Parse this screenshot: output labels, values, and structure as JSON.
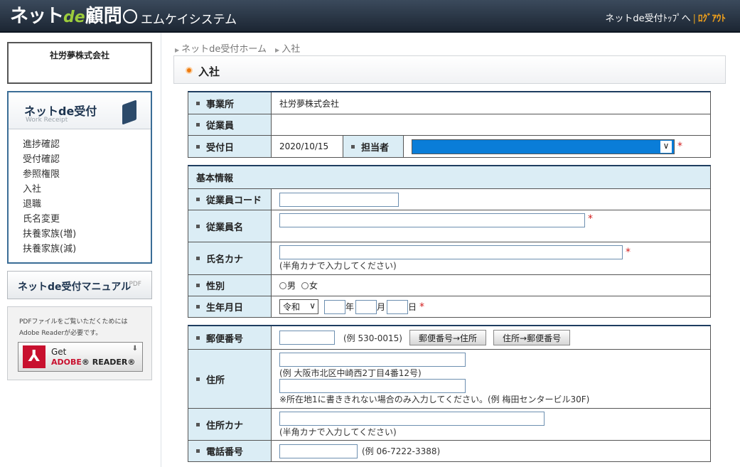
{
  "header": {
    "logo": {
      "part1": "ネット",
      "part2": "de",
      "part3": "顧問"
    },
    "company": "エムケイシステム",
    "link_top": "ネットde受付ﾄｯﾌﾟへ",
    "link_sep": "|",
    "link_logout": "ﾛｸﾞｱｳﾄ"
  },
  "sidebar": {
    "company": "社労夢株式会社",
    "panel_title": "ネットde受付",
    "panel_subtitle": "Work Receipt",
    "menu": [
      "進捗確認",
      "受付確認",
      "参照権限",
      "入社",
      "退職",
      "氏名変更",
      "扶養家族(増)",
      "扶養家族(減)"
    ],
    "manual_label": "ネットde受付マニュアル",
    "manual_tag": "PDF",
    "reader_note_1": "PDFファイルをご覧いただくためには",
    "reader_note_2": "Adobe Readerが必要です。",
    "reader_get": "Get",
    "reader_adobe": "ADOBE",
    "reader_reader": "® READER®"
  },
  "breadcrumb": [
    "ネットde受付ホーム",
    "入社"
  ],
  "page_title": "入社",
  "top_table": {
    "office_label": "事業所",
    "office_value": "社労夢株式会社",
    "employee_label": "従業員",
    "date_label": "受付日",
    "date_value": "2020/10/15",
    "staff_label": "担当者",
    "staff_value": ""
  },
  "basic": {
    "section": "基本情報",
    "code_label": "従業員コード",
    "name_label": "従業員名",
    "kana_label": "氏名カナ",
    "kana_hint": "(半角カナで入力してください)",
    "gender_label": "性別",
    "male": "男",
    "female": "女",
    "birth_label": "生年月日",
    "era_value": "令和",
    "year": "年",
    "month": "月",
    "day": "日"
  },
  "address": {
    "zip_label": "郵便番号",
    "zip_hint": "(例 530-0015)",
    "zip_to_addr": "郵便番号→住所",
    "addr_to_zip": "住所→郵便番号",
    "addr_label": "住所",
    "addr_hint1": "(例 大阪市北区中崎西2丁目4番12号)",
    "addr_hint2": "※所在地1に書ききれない場合のみ入力してください。(例 梅田センタービル30F)",
    "addr_kana_label": "住所カナ",
    "addr_kana_hint": "(半角カナで入力してください)",
    "tel_label": "電話番号",
    "tel_hint": "(例 06-7222-3388)"
  },
  "colors": {
    "accent": "#1e3d60",
    "label_bg": "#dbedf5",
    "required": "#d21e1e",
    "logout": "#f3a21b",
    "select_fill": "#0a7dd8"
  }
}
